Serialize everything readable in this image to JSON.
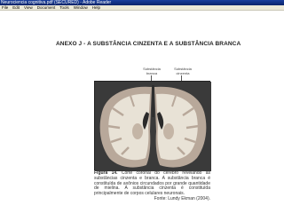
{
  "window": {
    "title": "Neurociencia cognitiva.pdf (SECURED) - Adobe Reader"
  },
  "menu": {
    "items": [
      "File",
      "Edit",
      "View",
      "Document",
      "Tools",
      "Window",
      "Help"
    ]
  },
  "document": {
    "heading": "ANEXO J - A SUBSTÂNCIA CINZENTA E A SUBSTÂNCIA BRANCA",
    "figure_labels": {
      "white_line1": "Substância",
      "white_line2": "branca",
      "gray_line1": "Substância",
      "gray_line2": "cinzenta"
    },
    "caption": {
      "label": "Figura 14.",
      "text": " Corte coronal do cérebro revelando as substâncias cinzenta e branca. A substância branca é constituída de axônios circundados por grande quantidade de mielina. A substância cinzenta é constituída principalmente de corpos celulares neuronais.",
      "source": "Fonte: Lundy Ekman (2004)."
    }
  },
  "colors": {
    "titlebar": "#0a246a",
    "menubar": "#ece9d8",
    "photo_background": "#3c3c3c",
    "white_matter": "#e8e2d6",
    "gray_matter": "#b8a89a"
  }
}
